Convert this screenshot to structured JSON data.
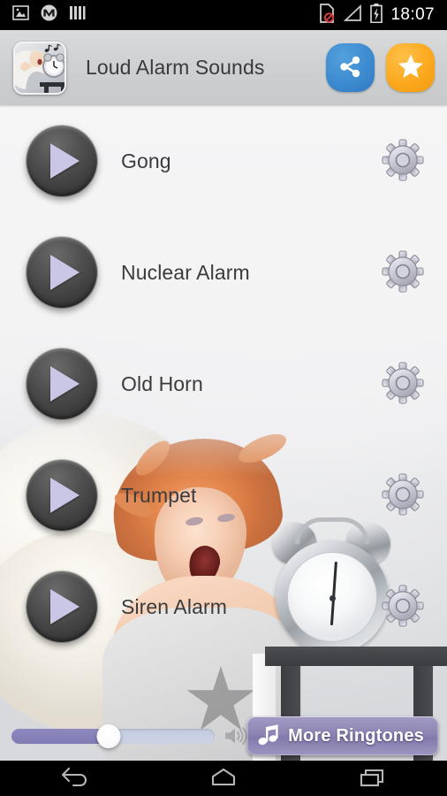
{
  "status_bar": {
    "time": "18:07",
    "icons": [
      {
        "name": "screenshot-icon"
      },
      {
        "name": "motorola-logo-icon"
      },
      {
        "name": "bars-icon"
      }
    ],
    "right_icons": [
      {
        "name": "sim-card-missing-icon"
      },
      {
        "name": "signal-no-service-icon"
      },
      {
        "name": "battery-charging-icon"
      }
    ]
  },
  "header": {
    "title": "Loud Alarm Sounds",
    "app_icon_name": "app-icon-alarm-clock",
    "share_label": "share-icon",
    "favorite_label": "star-icon",
    "share_color": "#3d8bd0",
    "favorite_color": "#fba91f"
  },
  "sounds": [
    {
      "name": "Gong"
    },
    {
      "name": "Nuclear Alarm"
    },
    {
      "name": "Old Horn"
    },
    {
      "name": "Trumpet"
    },
    {
      "name": "Siren Alarm"
    }
  ],
  "bottom_bar": {
    "volume_percent": 48,
    "speaker_icon": "speaker-volume-icon",
    "more_ringtones_label": "More Ringtones",
    "more_ringtones_icon": "music-note-icon",
    "button_color": "#8d84b4"
  },
  "nav_bar": {
    "back_label": "back-icon",
    "home_label": "home-icon",
    "recents_label": "recents-icon"
  },
  "colors": {
    "play_button": "#3b3b3c",
    "play_triangle": "#c9c6e6",
    "gear": "#bfbfcc",
    "slider_fill": "#817cb4",
    "header_bg": "#cfd0d2"
  }
}
